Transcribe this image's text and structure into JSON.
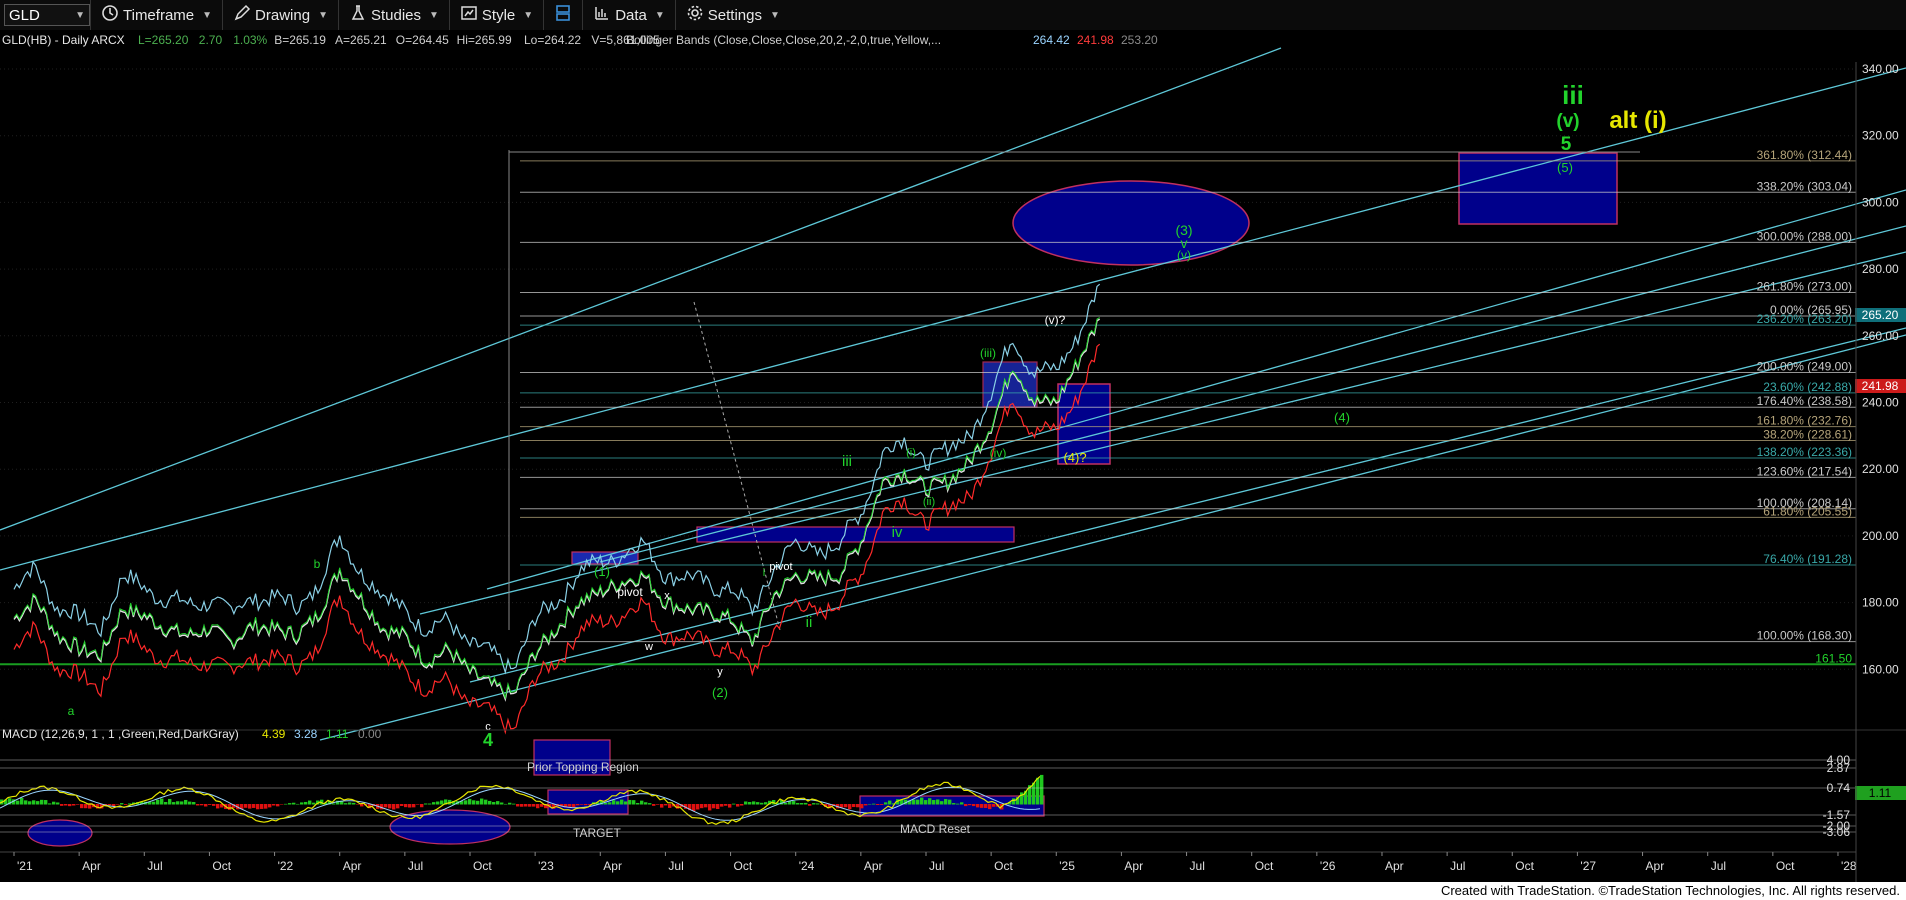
{
  "toolbar": {
    "symbol": "GLD",
    "timeframe_label": "Timeframe",
    "drawing_label": "Drawing",
    "studies_label": "Studies",
    "style_label": "Style",
    "data_label": "Data",
    "settings_label": "Settings"
  },
  "header": {
    "instrument": "GLD(HB) - Daily  ARCX",
    "quote_fields": [
      {
        "text": "L=265.20",
        "color": "#4caf50"
      },
      {
        "text": "2.70",
        "color": "#4caf50"
      },
      {
        "text": "1.03%",
        "color": "#4caf50"
      },
      {
        "text": "B=265.19",
        "color": "#cfcfcf"
      },
      {
        "text": "A=265.21",
        "color": "#cfcfcf"
      },
      {
        "text": "O=264.45",
        "color": "#cfcfcf"
      },
      {
        "text": "Hi=265.99",
        "color": "#cfcfcf"
      },
      {
        "text": "Lo=264.22",
        "color": "#cfcfcf"
      },
      {
        "text": "V=5,861,005",
        "color": "#cfcfcf"
      }
    ],
    "study": "Bollinger Bands (Close,Close,Close,20,2,-2,0,true,Yellow,...",
    "study_values": [
      {
        "text": "264.42",
        "color": "#9ad4ff"
      },
      {
        "text": "241.98",
        "color": "#ff3b3b"
      },
      {
        "text": "253.20",
        "color": "#8a8a8a"
      }
    ]
  },
  "chart_data": [
    {
      "type": "line",
      "title": "GLD(HB) - Daily",
      "x_axis_labels": [
        "'21",
        "Apr",
        "Jul",
        "Oct",
        "'22",
        "Apr",
        "Jul",
        "Oct",
        "'23",
        "Apr",
        "Jul",
        "Oct",
        "'24",
        "Apr",
        "Jul",
        "Oct",
        "'25",
        "Apr",
        "Jul",
        "Oct",
        "'26",
        "Apr",
        "Jul",
        "Oct",
        "'27",
        "Apr",
        "Jul",
        "Oct",
        "'28"
      ],
      "y_axis_labels": [
        "340.00",
        "320.00",
        "300.00",
        "280.00",
        "260.00",
        "240.00",
        "220.00",
        "200.00",
        "180.00",
        "160.00"
      ],
      "ylim": [
        146,
        346
      ],
      "last_price": "265.20",
      "band_lower_value": "241.98",
      "price_path": [
        [
          "'21",
          175
        ],
        [
          "Jan",
          181
        ],
        [
          "Feb",
          170
        ],
        [
          "Mar",
          166
        ],
        [
          "Apr",
          164
        ],
        [
          "May",
          178
        ],
        [
          "Jun",
          176
        ],
        [
          "Jul",
          172
        ],
        [
          "Aug",
          170
        ],
        [
          "Sep",
          172
        ],
        [
          "Oct",
          168
        ],
        [
          "Nov",
          173
        ],
        [
          "Dec",
          172
        ],
        [
          "'22",
          170
        ],
        [
          "Feb",
          176
        ],
        [
          "Mar",
          190
        ],
        [
          "Apr",
          181
        ],
        [
          "May",
          172
        ],
        [
          "Jun",
          170
        ],
        [
          "Jul",
          162
        ],
        [
          "Aug",
          166
        ],
        [
          "Sep",
          159
        ],
        [
          "Oct",
          155
        ],
        [
          "Nov",
          152
        ],
        [
          "Dec",
          165
        ],
        [
          "'23",
          172
        ],
        [
          "Feb",
          180
        ],
        [
          "Mar",
          183
        ],
        [
          "Apr",
          186
        ],
        [
          "May",
          188
        ],
        [
          "Jun",
          180
        ],
        [
          "Jul",
          178
        ],
        [
          "Aug",
          177
        ],
        [
          "Sep",
          175
        ],
        [
          "Oct",
          168
        ],
        [
          "Nov",
          182
        ],
        [
          "Dec",
          188
        ],
        [
          "'24",
          187
        ],
        [
          "Feb",
          188
        ],
        [
          "Mar",
          198
        ],
        [
          "Apr",
          216
        ],
        [
          "May",
          219
        ],
        [
          "Jun",
          214
        ],
        [
          "Jul",
          216
        ],
        [
          "Aug",
          222
        ],
        [
          "Sep",
          233
        ],
        [
          "Oct",
          251
        ],
        [
          "Nov",
          240
        ],
        [
          "Dec",
          240
        ],
        [
          "'25",
          252
        ],
        [
          "Feb",
          265
        ]
      ],
      "horizontal_levels": [
        {
          "label": "361.80% (312.44)",
          "value": 312.44,
          "color": "#b5a47a"
        },
        {
          "label": "338.20% (303.04)",
          "value": 303.04,
          "color": "#c9c9c9"
        },
        {
          "label": "300.00% (288.00)",
          "value": 288.0,
          "color": "#c9c9c9"
        },
        {
          "label": "261.80% (273.00)",
          "value": 273.0,
          "color": "#c9c9c9"
        },
        {
          "label": "0.00% (265.95)",
          "value": 265.95,
          "color": "#c9c9c9"
        },
        {
          "label": "236.20% (263.20)",
          "value": 263.2,
          "color": "#39a9a9"
        },
        {
          "label": "200.00% (249.00)",
          "value": 249.0,
          "color": "#c9c9c9"
        },
        {
          "label": "23.60% (242.88)",
          "value": 242.88,
          "color": "#39a9a9"
        },
        {
          "label": "176.40% (238.58)",
          "value": 238.58,
          "color": "#c9c9c9"
        },
        {
          "label": "161.80% (232.76)",
          "value": 232.76,
          "color": "#b5a47a"
        },
        {
          "label": "38.20% (228.61)",
          "value": 228.61,
          "color": "#b5a47a"
        },
        {
          "label": "138.20% (223.36)",
          "value": 223.36,
          "color": "#39a9a9"
        },
        {
          "label": "123.60% (217.54)",
          "value": 217.54,
          "color": "#c9c9c9"
        },
        {
          "label": "100.00% (208.14)",
          "value": 208.14,
          "color": "#c9c9c9"
        },
        {
          "label": "61.80% (205.55)",
          "value": 205.55,
          "color": "#b5a47a"
        },
        {
          "label": "76.40% (191.28)",
          "value": 191.28,
          "color": "#39a9a9"
        },
        {
          "label": "100.00% (168.30)",
          "value": 168.3,
          "color": "#c9c9c9"
        },
        {
          "label": "161.50",
          "value": 161.5,
          "color": "#22d32c"
        }
      ],
      "wave_labels": [
        {
          "text": "iii",
          "color": "#22d32c"
        },
        {
          "text": "(v)",
          "color": "#22d32c"
        },
        {
          "text": "5",
          "color": "#22d32c"
        },
        {
          "text": "alt (i)",
          "color": "#e6e600"
        },
        {
          "text": "(5)",
          "color": "#22d32c"
        },
        {
          "text": "(3)",
          "color": "#22d32c"
        },
        {
          "text": "v",
          "color": "#22d32c"
        },
        {
          "text": "(v)",
          "color": "#22d32c"
        },
        {
          "text": "(v)?",
          "color": "#ffffff"
        },
        {
          "text": "(iii)",
          "color": "#22d32c"
        },
        {
          "text": "(4)",
          "color": "#22d32c"
        },
        {
          "text": "(4)?",
          "color": "#e6e600"
        },
        {
          "text": "(iv)",
          "color": "#22d32c"
        },
        {
          "text": "(ii)",
          "color": "#22d32c"
        },
        {
          "text": "(i)",
          "color": "#22d32c"
        },
        {
          "text": "iii",
          "color": "#22d32c"
        },
        {
          "text": "iv",
          "color": "#22d32c"
        },
        {
          "text": "i",
          "color": "#22d32c"
        },
        {
          "text": "ii",
          "color": "#22d32c"
        },
        {
          "text": "(1)",
          "color": "#22d32c"
        },
        {
          "text": "pivot",
          "color": "#ffffff"
        },
        {
          "text": "pivot",
          "color": "#ffffff"
        },
        {
          "text": "x",
          "color": "#ffffff"
        },
        {
          "text": "w",
          "color": "#ffffff"
        },
        {
          "text": "y",
          "color": "#ffffff"
        },
        {
          "text": "(2)",
          "color": "#22d32c"
        },
        {
          "text": "b",
          "color": "#22d32c"
        },
        {
          "text": "a",
          "color": "#22d32c"
        },
        {
          "text": "c",
          "color": "#ffffff"
        },
        {
          "text": "4",
          "color": "#22d32c"
        }
      ]
    },
    {
      "type": "line",
      "title": "MACD (12,26,9, 1 , 1 ,Green,Red,DarkGray)",
      "study_values": [
        {
          "text": "4.39",
          "color": "#e6e600"
        },
        {
          "text": "3.28",
          "color": "#9ad4ff"
        },
        {
          "text": "1.11",
          "color": "#22d32c"
        },
        {
          "text": "0.00",
          "color": "#8a8a8a"
        }
      ],
      "y_axis_labels": [
        "4.00",
        "2.87",
        "0.74",
        "-1.57",
        "-2.00",
        "-3.06"
      ],
      "current_histogram": "1.11",
      "annotations": [
        "Prior Topping Region",
        "TARGET",
        "MACD Reset"
      ]
    }
  ],
  "footer": {
    "text": "Created with TradeStation. ©TradeStation Technologies, Inc. All rights reserved."
  }
}
